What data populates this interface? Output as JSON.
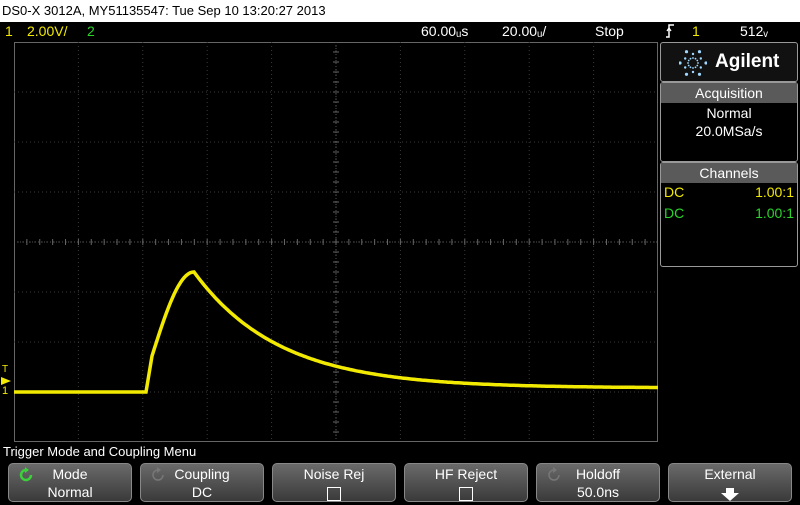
{
  "title": "DS0-X 3012A, MY51135547: Tue Sep 10 13:20:27 2013",
  "status": {
    "ch1_num": "1",
    "ch1_scale": "2.00V/",
    "ch2_num": "2",
    "time_pos": "60.00ᵤs",
    "time_scale": "20.00ᵤ/",
    "run_state": "Stop",
    "trig_icon": "trigger-edge-icon",
    "trig_src": "1",
    "trig_level": "512ᵥ",
    "colors": {
      "ch1": "#f2ea00",
      "ch2": "#2ad42a",
      "accent": "#f28c00"
    }
  },
  "brand": "Agilent",
  "acquisition": {
    "header": "Acquisition",
    "mode": "Normal",
    "rate": "20.0MSa/s"
  },
  "channels": {
    "header": "Channels",
    "rows": [
      {
        "coupling": "DC",
        "ratio": "1.00:1",
        "color": "#f2ea00"
      },
      {
        "coupling": "DC",
        "ratio": "1.00:1",
        "color": "#2ad42a"
      }
    ]
  },
  "menu_title": "Trigger Mode and Coupling Menu",
  "softkeys": [
    {
      "label": "Mode",
      "value": "Normal"
    },
    {
      "label": "Coupling",
      "value": "DC"
    },
    {
      "label": "Noise Rej",
      "value": ""
    },
    {
      "label": "HF Reject",
      "value": ""
    },
    {
      "label": "Holdoff",
      "value": "50.0ns"
    },
    {
      "label": "External",
      "value": ""
    }
  ],
  "markers": {
    "ch1_ground": "1",
    "trig_marker": "T"
  }
}
